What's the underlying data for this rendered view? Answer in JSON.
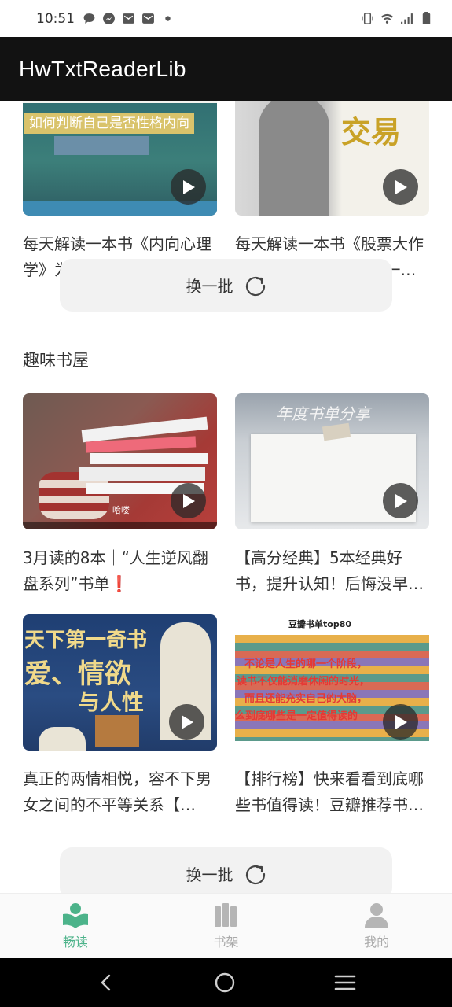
{
  "status": {
    "time": "10:51",
    "left_icons": [
      "chat-bubble-icon",
      "messenger-icon",
      "mail-icon",
      "mail-icon",
      "dot-icon"
    ],
    "right_icons": [
      "vibrate-icon",
      "wifi-icon",
      "signal-icon",
      "battery-icon"
    ]
  },
  "app_bar": {
    "title": "HwTxtReaderLib"
  },
  "top_cards": [
    {
      "title": "每天解读一本书《内向心理学》为什么越内向的人越…",
      "thumb_text": "如何判断自己是否性格内向"
    },
    {
      "title": "每天解读一本书《股票大作手回忆录》“你可能是一时…",
      "thumb_text": "交易"
    }
  ],
  "refresh_label": "换一批",
  "section": {
    "title": "趣味书屋"
  },
  "fun_cards": [
    {
      "title": "3月读的8本｜“人生逆风翻盘系列”书单❗",
      "thumb_text": "哈喽"
    },
    {
      "title": "【高分经典】5本经典好书，提升认知！后悔没早点看…",
      "thumb_text": "年度书单分享"
    },
    {
      "title": "真正的两情相悦，容不下男女之间的不平等关系【…",
      "thumb_line1": "天下第一奇书",
      "thumb_line2": "爱、情欲",
      "thumb_line3": "与人性"
    },
    {
      "title": "【排行榜】快来看看到底哪些书值得读！豆瓣推荐书单…",
      "thumb_header": "豆瓣书单top80",
      "thumb_line1": "不论是人生的哪一个阶段，",
      "thumb_line2": "读书不仅能消磨休闲的时光，",
      "thumb_line3": "而且还能充实自己的大脑，",
      "thumb_line4": "么到底哪些是一定值得读的"
    }
  ],
  "bottom_nav": [
    {
      "label": "畅读",
      "icon": "reading-icon",
      "active": true
    },
    {
      "label": "书架",
      "icon": "bookshelf-icon",
      "active": false
    },
    {
      "label": "我的",
      "icon": "profile-icon",
      "active": false
    }
  ],
  "colors": {
    "accent": "#4cb38a",
    "app_bar": "#121212"
  }
}
